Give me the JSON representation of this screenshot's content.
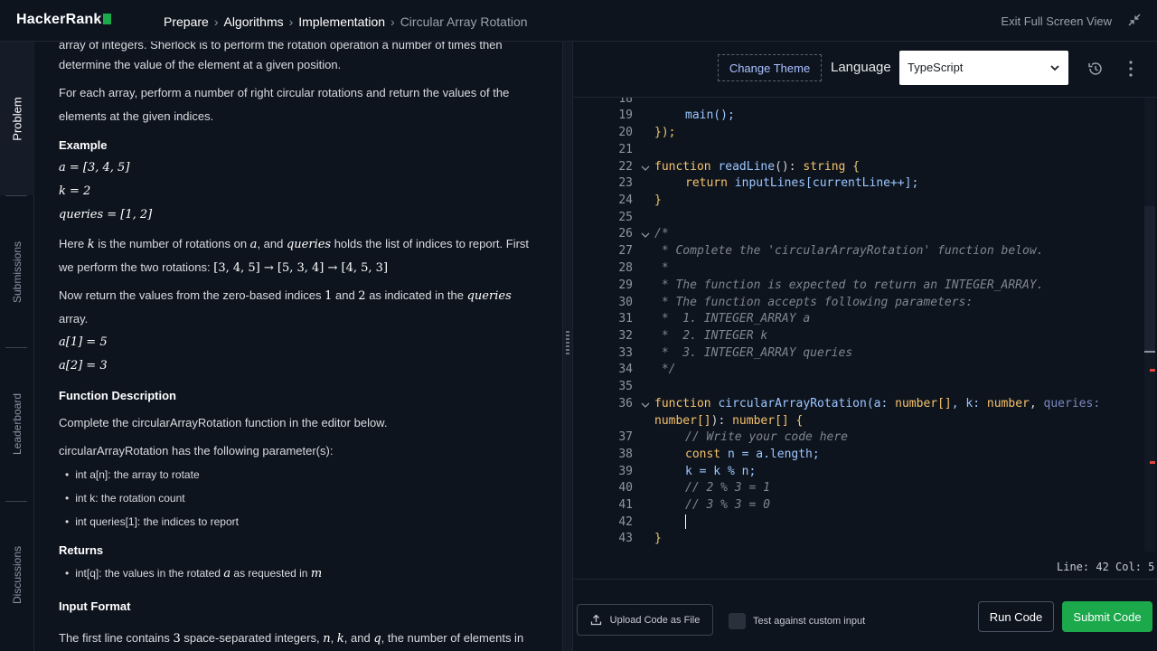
{
  "app": {
    "logo": "HackerRank",
    "breadcrumb": [
      "Prepare",
      "Algorithms",
      "Implementation",
      "Circular Array Rotation"
    ],
    "exit_fullscreen": "Exit Full Screen View",
    "accent": "#1ba94c"
  },
  "sidebar": {
    "tabs": [
      {
        "label": "Problem",
        "active": true
      },
      {
        "label": "Submissions",
        "active": false
      },
      {
        "label": "Leaderboard",
        "active": false
      },
      {
        "label": "Discussions",
        "active": false
      }
    ]
  },
  "problem": {
    "intro_line1": "array of integers. Sherlock is to perform the rotation operation a number of times then",
    "intro_line2": "determine the value of the element at a given position.",
    "para1_line1": "For each array, perform a number of right circular rotations and return the values of the",
    "para1_line2": "elements at the given indices.",
    "example_heading": "Example",
    "ex_a": "a = [3, 4, 5]",
    "ex_k": "k = 2",
    "ex_q": "queries = [1, 2]",
    "here_line1_a": "Here ",
    "here_k": "k",
    "here_line1_b": " is the number of rotations on ",
    "here_a": "a",
    "here_line1_c": ", and ",
    "here_queries": "queries",
    "here_line1_d": " holds the list of indices to report. First",
    "here_line2_a": "we perform the two rotations: ",
    "here_line2_math": "[3, 4, 5] → [5, 3, 4] → [4, 5, 3]",
    "now_a": "Now return the values from the zero-based indices ",
    "now_1": "1",
    "now_b": " and ",
    "now_2": "2",
    "now_c": " as indicated in the ",
    "now_q": "queries",
    "now_line2": "array.",
    "res1": "a[1] = 5",
    "res2": "a[2] = 3",
    "func_heading": "Function Description",
    "func_desc": "Complete the circularArrayRotation function in the editor below.",
    "params_intro": "circularArrayRotation has the following parameter(s):",
    "params": [
      "int a[n]: the array to rotate",
      "int k: the rotation count",
      "int queries[1]: the indices to report"
    ],
    "returns_heading": "Returns",
    "returns_a": "int[q]: the values in the rotated ",
    "returns_math": "a",
    "returns_b": " as requested in ",
    "returns_m": "m",
    "input_heading": "Input Format",
    "input_a": "The first line contains ",
    "input_3": "3",
    "input_b": " space-separated integers, ",
    "input_n": "n",
    "input_c": ", ",
    "input_k": "k",
    "input_d": ", and ",
    "input_q": "q",
    "input_e": ", the number of elements in"
  },
  "editor": {
    "change_theme": "Change Theme",
    "language_label": "Language",
    "language_value": "TypeScript",
    "status": "Line: 42 Col: 5",
    "line_numbers": [
      "18",
      "19",
      "20",
      "21",
      "22",
      "23",
      "24",
      "25",
      "26",
      "27",
      "28",
      "29",
      "30",
      "31",
      "32",
      "33",
      "34",
      "35",
      "36",
      "",
      "37",
      "38",
      "39",
      "40",
      "41",
      "42",
      "43"
    ],
    "code": {
      "l19": "main();",
      "l20_close": "});",
      "l22_kw": "function",
      "l22_fn": "readLine",
      "l22_rest": "(): ",
      "l22_type": "string",
      "l22_brace": " {",
      "l23_kw": "return",
      "l23_rest": " inputLines[currentLine++];",
      "l24": "}",
      "l26": "/*",
      "l27": " * Complete the 'circularArrayRotation' function below.",
      "l28": " *",
      "l29": " * The function is expected to return an INTEGER_ARRAY.",
      "l30": " * The function accepts following parameters:",
      "l31": " *  1. INTEGER_ARRAY a",
      "l32": " *  2. INTEGER k",
      "l33": " *  3. INTEGER_ARRAY queries",
      "l34": " */",
      "l36_kw": "function",
      "l36_fn": "circularArrayRotation",
      "l36_p1": "(a: ",
      "l36_t1": "number[]",
      "l36_p2": ", k: ",
      "l36_t2": "number",
      "l36_p3": ", ",
      "l36_q": "queries:",
      "l36b_t": "number[]",
      "l36b_p": "): ",
      "l36b_t2": "number[]",
      "l36b_brace": " {",
      "l37": "// Write your code here",
      "l38_kw": "const",
      "l38_rest": " n = a.length;",
      "l39": "k = k % n;",
      "l40": "// 2 % 3 = 1",
      "l41": "// 3 % 3 = 0",
      "l43": "}"
    }
  },
  "footer": {
    "upload": "Upload Code as File",
    "custom_input": "Test against custom input",
    "run": "Run Code",
    "submit": "Submit Code"
  }
}
